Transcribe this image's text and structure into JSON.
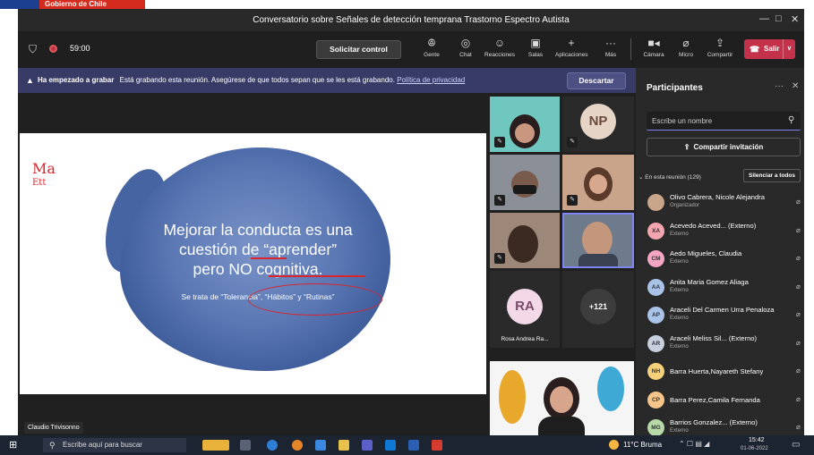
{
  "gov_label": "Gobierno de Chile",
  "window": {
    "title": "Conversatorio sobre Señales de detección temprana Trastorno Espectro Autista"
  },
  "toolbar": {
    "timer": "59:00",
    "request_control": "Solicitar control",
    "items": [
      {
        "label": "Gente",
        "icon": "people-icon"
      },
      {
        "label": "Chat",
        "icon": "chat-icon"
      },
      {
        "label": "Reacciones",
        "icon": "reactions-icon"
      },
      {
        "label": "Salas",
        "icon": "rooms-icon"
      },
      {
        "label": "Aplicaciones",
        "icon": "plus-icon"
      },
      {
        "label": "Más",
        "icon": "more-icon"
      },
      {
        "label": "Cámara",
        "icon": "camera-icon"
      },
      {
        "label": "Micro",
        "icon": "mic-off-icon"
      },
      {
        "label": "Compartir",
        "icon": "share-icon"
      }
    ],
    "leave": "Salir"
  },
  "banner": {
    "bold": "Ha empezado a grabar",
    "text": "Está grabando esta reunión. Asegúrese de que todos sepan que se les está grabando.",
    "link": "Política de privacidad",
    "dismiss": "Descartar"
  },
  "slide": {
    "ink_top": "Ma",
    "ink_bottom": "Ett",
    "line1": "Mejorar la conducta es una",
    "line2": "cuestión de “aprender”",
    "line3": "pero NO cognitiva.",
    "sub": "Se trata de “Tolerancia”, “Hábitos” y “Rutinas”"
  },
  "presenter_name": "Claudio Trivisonno",
  "gallery": {
    "np_initials": "NP",
    "ra_initials": "RA",
    "ra_name": "Rosa Andrea Ra...",
    "more_count": "+121"
  },
  "panel": {
    "title": "Participantes",
    "search_placeholder": "Escribe un nombre",
    "invite": "Compartir invitación",
    "in_meeting": "En esta reunión (129)",
    "mute_all": "Silenciar a todos",
    "people": [
      {
        "initials": "",
        "name": "Olivo Cabrera, Nicole Alejandra",
        "role": "Organizador",
        "color": "#c9a58a"
      },
      {
        "initials": "XA",
        "name": "Acevedo Aceved... (Externo)",
        "role": "Externo",
        "color": "#f4a6b0"
      },
      {
        "initials": "CM",
        "name": "Aedo Migueles, Claudia",
        "role": "Externo",
        "color": "#f6a6c4"
      },
      {
        "initials": "AA",
        "name": "Anita Maria Gomez Aliaga",
        "role": "Externo",
        "color": "#a9c2e8"
      },
      {
        "initials": "AP",
        "name": "Araceli Del Carmen Urra Penaloza",
        "role": "Externo",
        "color": "#a9c2e8"
      },
      {
        "initials": "AR",
        "name": "Araceli Meliss Sil... (Externo)",
        "role": "Externo",
        "color": "#c8d0e0"
      },
      {
        "initials": "NH",
        "name": "Barra Huerta,Nayareth Stefany",
        "role": "",
        "color": "#f7d07a"
      },
      {
        "initials": "CP",
        "name": "Barra Perez,Camila Fernanda",
        "role": "",
        "color": "#f7c58a"
      },
      {
        "initials": "MG",
        "name": "Barrios Gonzalez... (Externo)",
        "role": "Externo",
        "color": "#b7d9a8"
      }
    ]
  },
  "taskbar": {
    "search": "Escribe aquí para buscar",
    "weather": "11°C  Bruma",
    "time": "15:42",
    "date": "01-06-2022"
  }
}
